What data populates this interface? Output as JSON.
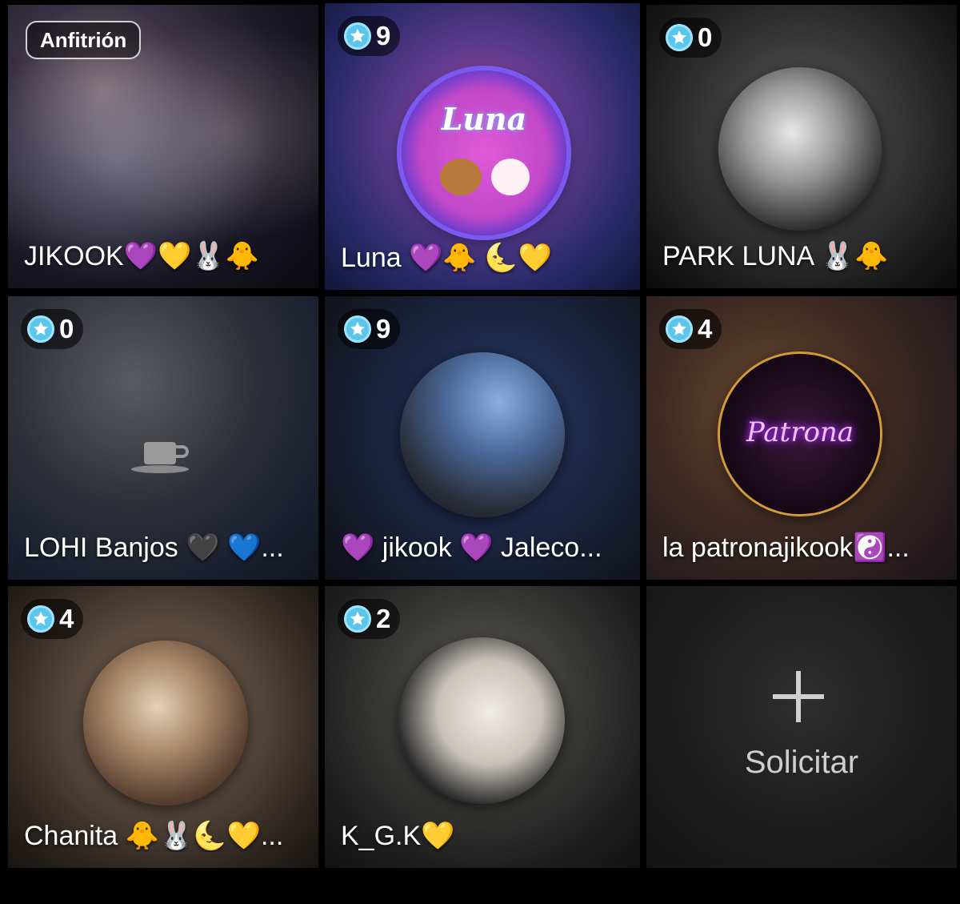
{
  "host_badge": "Anfitrión",
  "icons": {
    "star": "star-badge-icon",
    "cup": "coffee-cup-icon",
    "plus": "plus-icon"
  },
  "tiles": [
    {
      "name": "JIKOOK💜💛🐰🐥",
      "score": null
    },
    {
      "name": "Luna 💜🐥 🌜💛",
      "score": "9",
      "avatar_text": "Luna"
    },
    {
      "name": "PARK LUNA 🐰🐥",
      "score": "0"
    },
    {
      "name": "LOHI Banjos 🖤 💙...",
      "score": "0"
    },
    {
      "name": "💜 jikook 💜 Jaleco...",
      "score": "9"
    },
    {
      "name": "la patronajikook☯️...",
      "score": "4",
      "avatar_text": "Patrona"
    },
    {
      "name": "Chanita 🐥🐰🌜💛...",
      "score": "4"
    },
    {
      "name": "K_G.K💛",
      "score": "2"
    }
  ],
  "request_label": "Solicitar",
  "colors": {
    "accent": "#5bc6ec",
    "selected_border": "#5fd3ff"
  }
}
